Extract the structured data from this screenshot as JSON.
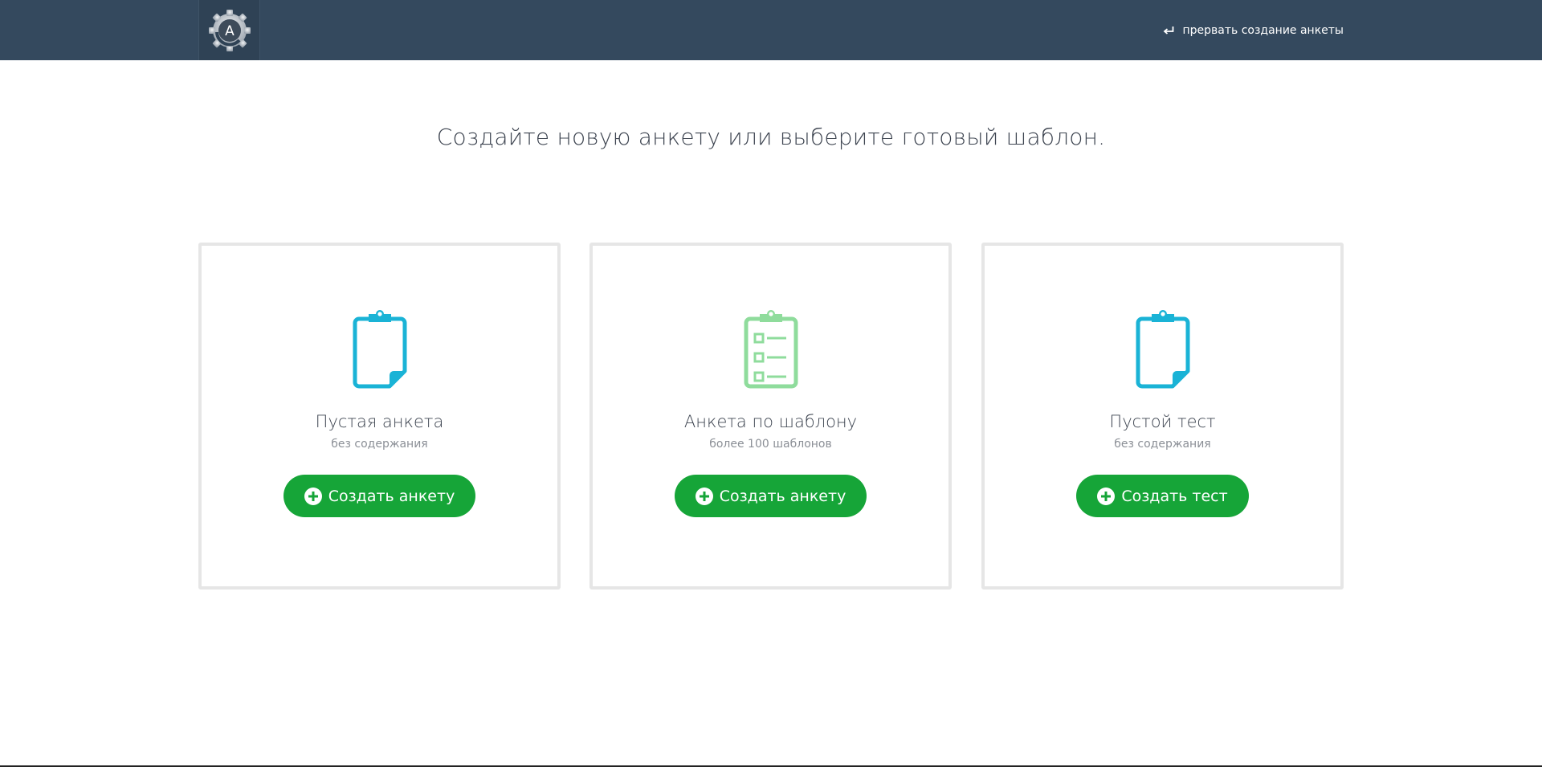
{
  "header": {
    "logo_letter": "A",
    "abort_label": "прервать создание анкеты",
    "background": "#34495e"
  },
  "main": {
    "title": "Создайте новую анкету или выберите готовый шаблон."
  },
  "cards": [
    {
      "icon": "blank-clipboard-icon",
      "title": "Пустая анкета",
      "subtitle": "без содержания",
      "button_label": "Создать анкету",
      "icon_color": "#1ab3d6"
    },
    {
      "icon": "checklist-clipboard-icon",
      "title": "Анкета по шаблону",
      "subtitle": "более 100 шаблонов",
      "button_label": "Создать анкету",
      "icon_color": "#8fdc9c"
    },
    {
      "icon": "blank-clipboard-icon",
      "title": "Пустой тест",
      "subtitle": "без содержания",
      "button_label": "Создать тест",
      "icon_color": "#1ab3d6"
    }
  ],
  "colors": {
    "button": "#16a538",
    "card_border": "#e6e6e6",
    "title_text": "#3d4450"
  }
}
